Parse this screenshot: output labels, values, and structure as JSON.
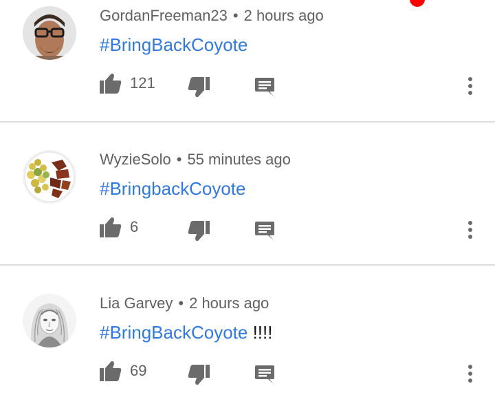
{
  "notification_dot_color": "#ff0000",
  "colors": {
    "hashtag": "#2f79e0",
    "meta": "#606060",
    "icon": "#6b6b6b",
    "divider": "#dcdcdc"
  },
  "comments": [
    {
      "author": "GordanFreeman23",
      "separator": "•",
      "time": "2 hours ago",
      "hashtag": "#BringBackCoyote",
      "suffix": "",
      "likes": "121",
      "avatar_icon": "avatar-glasses-man"
    },
    {
      "author": "WyzieSolo",
      "separator": "•",
      "time": "55 minutes ago",
      "hashtag": "#BringbackCoyote",
      "suffix": "",
      "likes": "6",
      "avatar_icon": "avatar-food-plate"
    },
    {
      "author": "Lia Garvey",
      "separator": "•",
      "time": "2 hours ago",
      "hashtag": "#BringBackCoyote",
      "suffix": " !!!!",
      "likes": "69",
      "avatar_icon": "avatar-sketch-girl"
    }
  ]
}
